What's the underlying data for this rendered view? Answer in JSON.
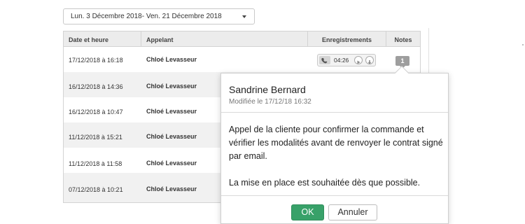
{
  "filter": {
    "date_range": "Lun. 3 Décembre  2018- Ven. 21 Décembre 2018"
  },
  "table": {
    "headers": {
      "date": "Date et heure",
      "caller": "Appelant",
      "recordings": "Enregistrements",
      "notes": "Notes"
    },
    "rows": [
      {
        "date": "17/12/2018 à 16:18",
        "caller": "Chloé Levasseur"
      },
      {
        "date": "16/12/2018 à 14:36",
        "caller": "Chloé Levasseur"
      },
      {
        "date": "16/12/2018 à 10:47",
        "caller": "Chloé Levasseur"
      },
      {
        "date": "11/12/2018 à 15:21",
        "caller": "Chloé Levasseur"
      },
      {
        "date": "11/12/2018 à 11:58",
        "caller": "Chloé Levasseur"
      },
      {
        "date": "07/12/2018 à 10:21",
        "caller": "Chloé Levasseur"
      }
    ],
    "recording": {
      "duration": "04:26",
      "icons": [
        "phone-icon",
        "play-icon",
        "download-icon"
      ]
    },
    "note_count": "1"
  },
  "note_popover": {
    "author": "Sandrine Bernard",
    "modified": "Modifiée le 17/12/18 16:32",
    "paragraph1": "Appel de la cliente pour confirmer la commande et vérifier les modalités avant de renvoyer le contrat signé par email.",
    "paragraph2": "La mise en place est souhaitée dès que possible.",
    "ok_label": "OK",
    "cancel_label": "Annuler"
  },
  "colors": {
    "ok_button": "#38a169",
    "header_bg": "#ececec",
    "alt_row_bg": "#f1f1f1",
    "note_badge": "#9e9e9e"
  }
}
